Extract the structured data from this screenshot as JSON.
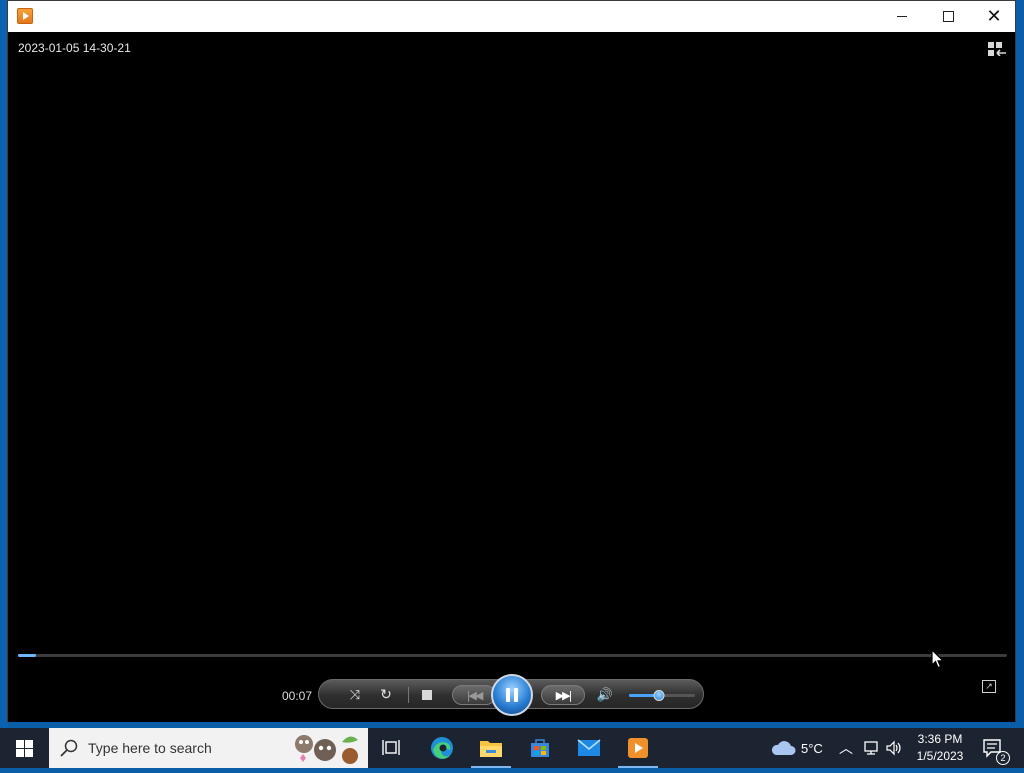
{
  "window": {
    "minimize_glyph": "",
    "close_glyph": "✕"
  },
  "video": {
    "timestamp": "2023-01-05 14-30-21",
    "seek_fraction": 0.018
  },
  "controls": {
    "elapsed": "00:07",
    "shuffle_glyph": "⤨",
    "repeat_glyph": "↻",
    "prev_glyph": "|◀◀",
    "next_glyph": "▶▶|",
    "volume_glyph": "🔊",
    "volume_fraction": 0.45,
    "fullscreen_glyph": "↗"
  },
  "taskbar": {
    "search_placeholder": "Type here to search",
    "temperature": "5°C",
    "time": "3:36 PM",
    "date": "1/5/2023",
    "notification_count": "2",
    "accent": "#7fb8f0"
  }
}
